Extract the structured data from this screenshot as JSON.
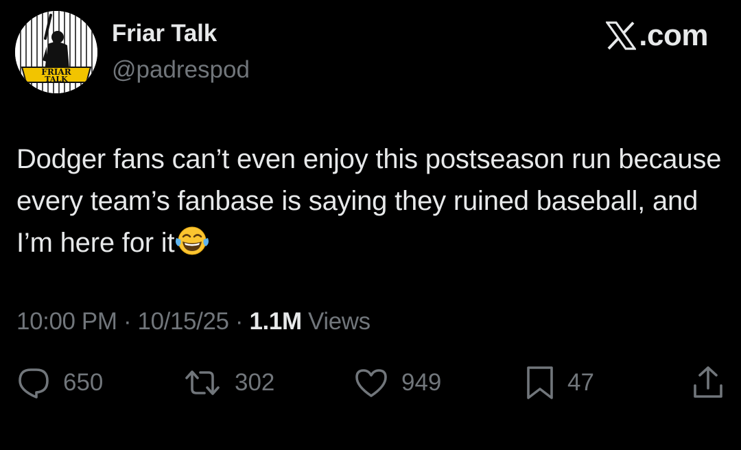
{
  "author": {
    "name": "Friar Talk",
    "handle": "@padrespod",
    "avatar_logo_text": "FRIAR TALK"
  },
  "brand": {
    "text": ".com",
    "icon": "x-logo-icon"
  },
  "tweet": {
    "text": "Dodger fans can’t even enjoy this postseason run because every team’s fanbase is saying they ruined baseball, and I’m here for it",
    "emoji": "face-with-tears-of-joy-icon"
  },
  "meta": {
    "time": "10:00 PM",
    "separator": " · ",
    "date": "10/15/25",
    "views_count": "1.1M",
    "views_label": " Views"
  },
  "actions": {
    "reply_count": "650",
    "retweet_count": "302",
    "like_count": "949",
    "bookmark_count": "47"
  },
  "colors": {
    "background": "#000000",
    "primary_text": "#e7e9ea",
    "secondary_text": "#71767b"
  }
}
